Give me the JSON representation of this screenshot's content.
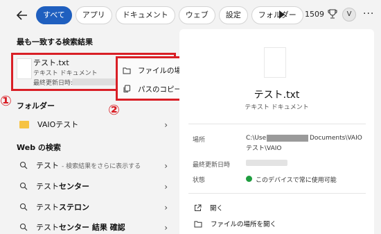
{
  "filters": [
    "すべて",
    "アプリ",
    "ドキュメント",
    "ウェブ",
    "設定",
    "フォルダー"
  ],
  "topbar": {
    "points": "1509",
    "avatar": "V",
    "more": "···"
  },
  "best_match": {
    "heading": "最も一致する検索結果",
    "file_name": "テスト.txt",
    "file_type": "テキスト ドキュメント",
    "modified_label": "最終更新日時:"
  },
  "context_menu": {
    "open_location": "ファイルの場所を開く",
    "copy_path": "パスのコピー"
  },
  "annotations": {
    "one": "①",
    "two": "②"
  },
  "folders": {
    "heading": "フォルダー",
    "items": [
      {
        "label": "VAIOテスト"
      }
    ]
  },
  "web": {
    "heading": "Web の検索",
    "items": [
      {
        "prefix": "テスト",
        "bold": "",
        "sub": "- 検索結果をさらに表示する"
      },
      {
        "prefix": "テスト",
        "bold": "センター",
        "sub": ""
      },
      {
        "prefix": "テスト",
        "bold": "ステロン",
        "sub": ""
      },
      {
        "prefix": "テスト",
        "bold": "センター 結果 確認",
        "sub": ""
      }
    ]
  },
  "detail": {
    "title": "テスト.txt",
    "type": "テキスト ドキュメント",
    "location_label": "場所",
    "location_prefix": "C:\\Users",
    "location_suffix": "Documents\\VAIO",
    "location_line2": "テスト\\VAIO",
    "modified_label": "最終更新日時",
    "status_label": "状態",
    "status_value": "このデバイスで常に使用可能",
    "actions": {
      "open": "開く",
      "open_location": "ファイルの場所を開く"
    }
  },
  "colors": {
    "accent": "#1f5fbf",
    "annotation_red": "#d91f26",
    "status_ok": "#1f9d3f"
  }
}
